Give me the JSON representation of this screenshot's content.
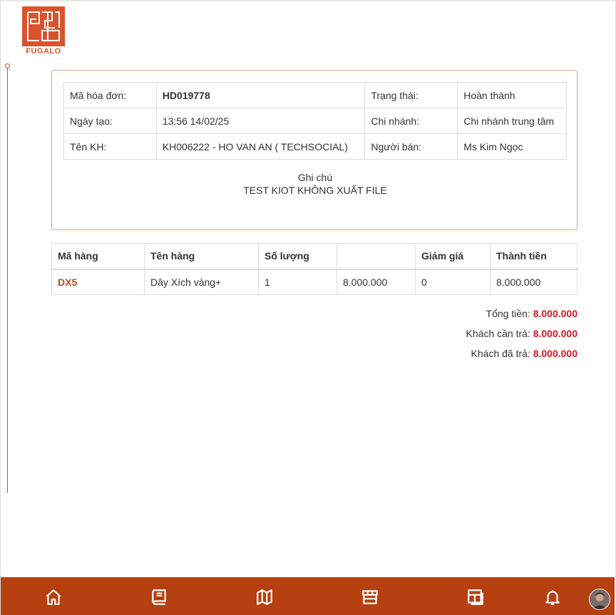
{
  "brand": {
    "name": "FUGALO",
    "accent": "#b64010"
  },
  "invoice": {
    "rows": [
      {
        "k1": "Mã hóa đơn:",
        "v1": "HD019778",
        "k2": "Trạng thái:",
        "v2": "Hoàn thành"
      },
      {
        "k1": "Ngày tạo:",
        "v1": "13:56 14/02/25",
        "k2": "Chi nhánh:",
        "v2": "Chi nhánh trung tâm"
      },
      {
        "k1": "Tên KH:",
        "v1": "KH006222 - HO VAN AN ( TECHSOCIAL)",
        "k2": "Người bán:",
        "v2": "Ms Kim Ngọc"
      }
    ],
    "note_label": "Ghi chú",
    "note_text": "TEST KIOT KHÔNG XUẤT FILE"
  },
  "products": {
    "headers": [
      "Mã hàng",
      "Tên hàng",
      "Số lượng",
      "",
      "Giảm giá",
      "Thành tiền"
    ],
    "rows": [
      [
        "DX5",
        "Dây Xích vàng+",
        "1",
        "8.000.000",
        "0",
        "8.000.000"
      ]
    ]
  },
  "totals": {
    "total_label": "Tổng tiền:",
    "total_value": "8.000.000",
    "due_label": "Khách cần trả:",
    "due_value": "8.000.000",
    "paid_label": "Khách đã trả:",
    "paid_value": "8.000.000"
  },
  "nav": {
    "items": [
      "home-icon",
      "book-icon",
      "map-icon",
      "store-icon",
      "layout-icon",
      "bell-icon",
      "avatar"
    ]
  }
}
